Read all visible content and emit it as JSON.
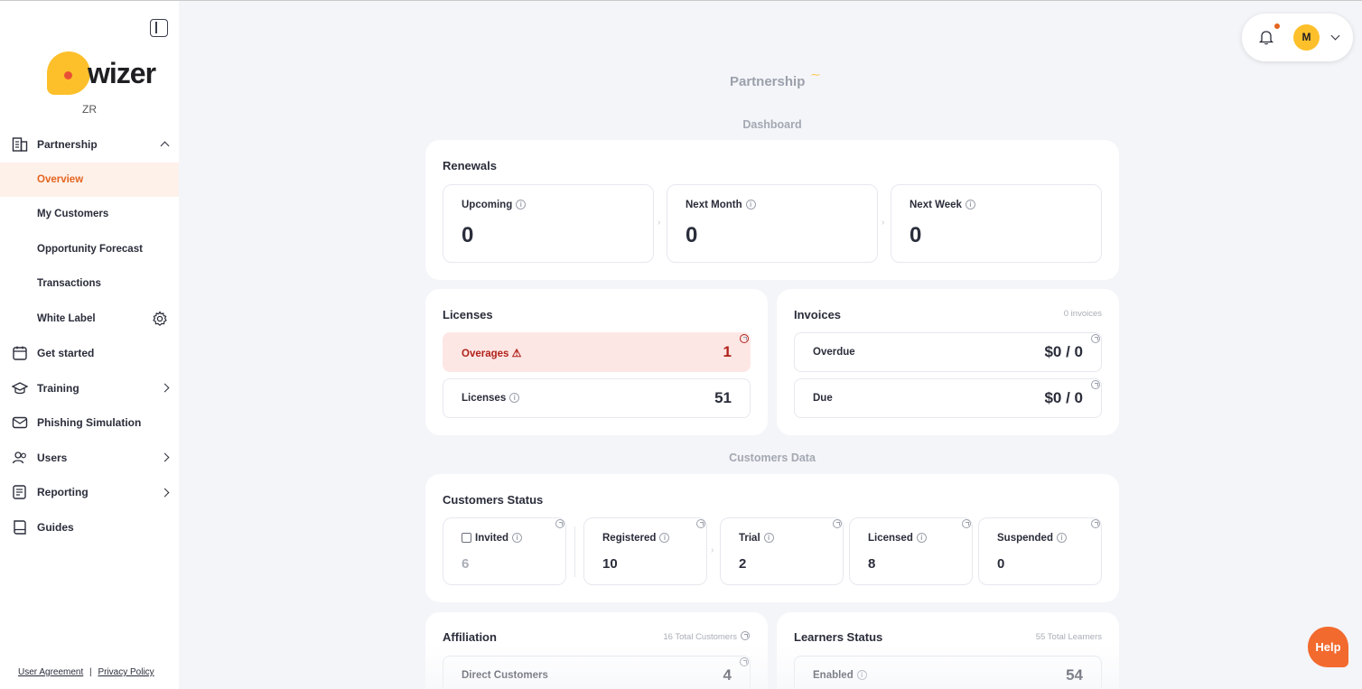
{
  "sidebar": {
    "brand": "wizer",
    "tenant": "ZR",
    "nav": [
      {
        "label": "Partnership",
        "icon": "building-icon"
      },
      {
        "label": "Get started",
        "icon": "calendar-icon"
      },
      {
        "label": "Training",
        "icon": "graduation-cap-icon"
      },
      {
        "label": "Phishing Simulation",
        "icon": "mail-hook-icon"
      },
      {
        "label": "Users",
        "icon": "users-icon"
      },
      {
        "label": "Reporting",
        "icon": "report-icon"
      },
      {
        "label": "Guides",
        "icon": "book-icon"
      }
    ],
    "partnership_sub": [
      "Overview",
      "My Customers",
      "Opportunity Forecast",
      "Transactions",
      "White Label"
    ],
    "footer": {
      "user_agreement": "User Agreement",
      "separator": "|",
      "privacy": "Privacy Policy"
    }
  },
  "header": {
    "avatar_initial": "M"
  },
  "page": {
    "title": "Partnership",
    "dashboard_label": "Dashboard",
    "customers_data_label": "Customers Data"
  },
  "renewals": {
    "title": "Renewals",
    "tiles": [
      {
        "label": "Upcoming",
        "value": "0"
      },
      {
        "label": "Next Month",
        "value": "0"
      },
      {
        "label": "Next Week",
        "value": "0"
      }
    ]
  },
  "licenses": {
    "title": "Licenses",
    "rows": [
      {
        "label": "Overages",
        "value": "1"
      },
      {
        "label": "Licenses",
        "value": "51"
      }
    ]
  },
  "invoices": {
    "title": "Invoices",
    "meta": "0 invoices",
    "rows": [
      {
        "label": "Overdue",
        "value": "$0 / 0"
      },
      {
        "label": "Due",
        "value": "$0 / 0"
      }
    ]
  },
  "customers_status": {
    "title": "Customers Status",
    "tiles": [
      {
        "label": "Invited",
        "value": "6"
      },
      {
        "label": "Registered",
        "value": "10"
      },
      {
        "label": "Trial",
        "value": "2"
      },
      {
        "label": "Licensed",
        "value": "8"
      },
      {
        "label": "Suspended",
        "value": "0"
      }
    ]
  },
  "affiliation": {
    "title": "Affiliation",
    "meta": "16 Total Customers",
    "rows": [
      {
        "label": "Direct Customers",
        "value": "4"
      }
    ]
  },
  "learners": {
    "title": "Learners Status",
    "meta": "55 Total Learners",
    "rows": [
      {
        "label": "Enabled",
        "value": "54"
      }
    ]
  },
  "help": {
    "label": "Help"
  },
  "colors": {
    "accent": "#e5641f",
    "brand_yellow": "#fdc02b",
    "alert_bg": "#fde7e5",
    "alert_text": "#b0221a"
  }
}
